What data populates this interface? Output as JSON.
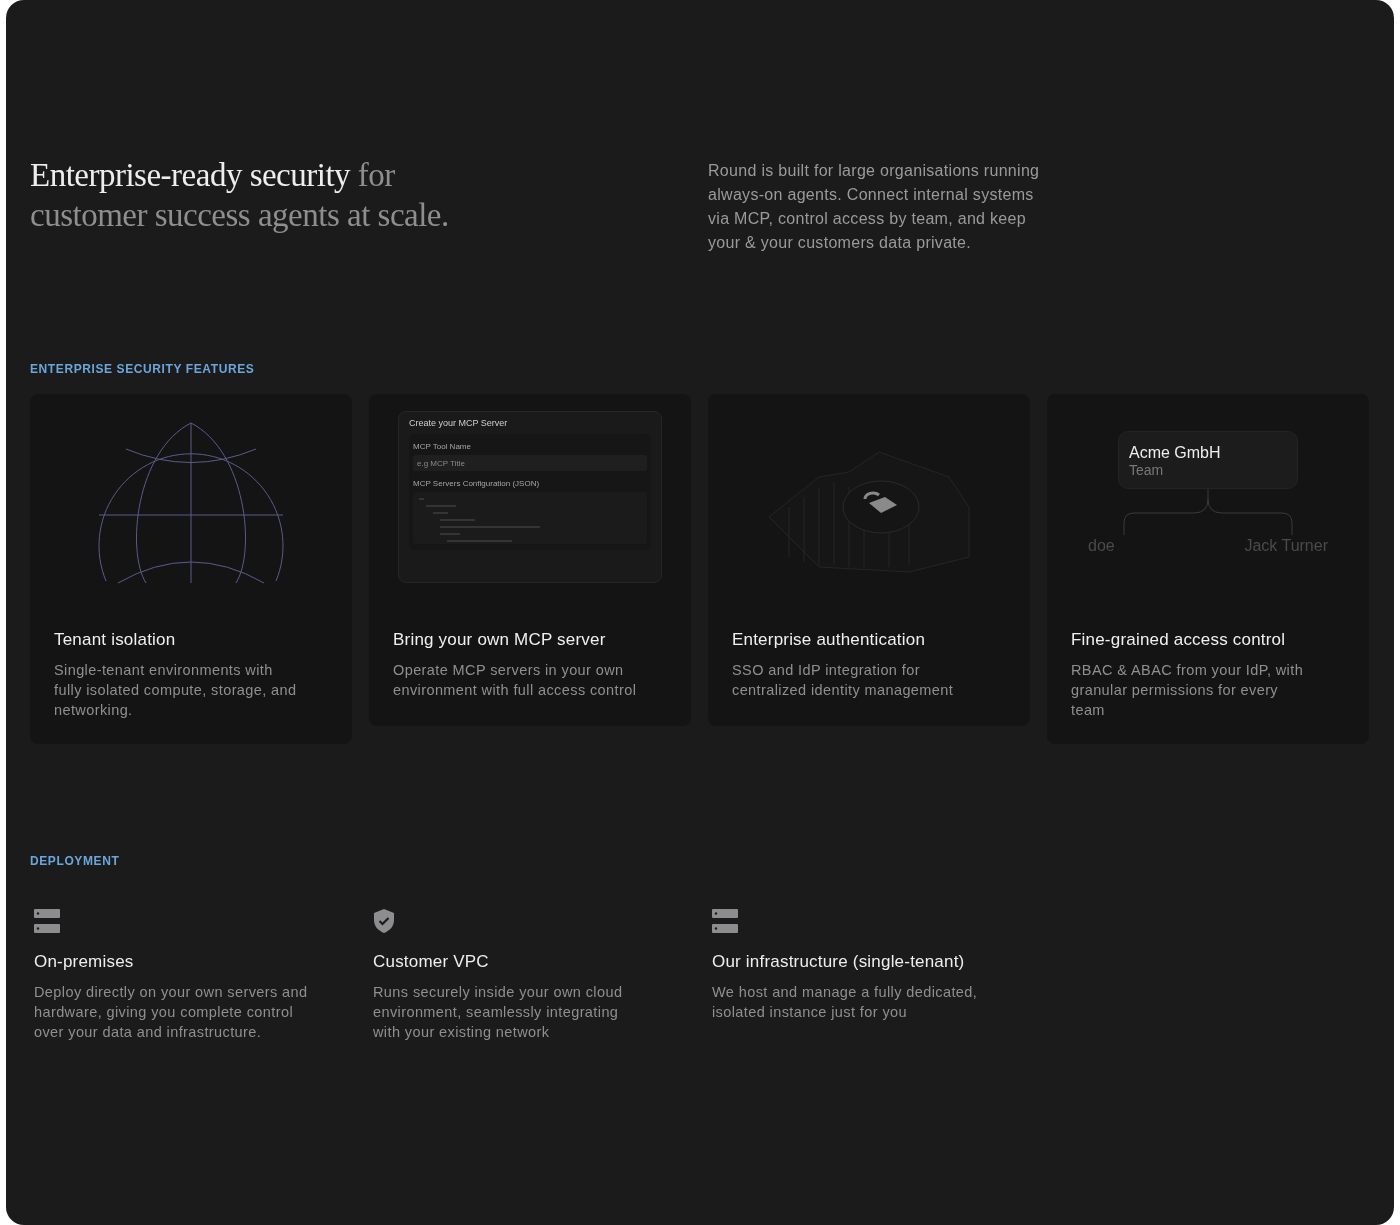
{
  "hero": {
    "title_strong": "Enterprise-ready security",
    "title_muted_1": "for",
    "title_muted_2": "customer success agents at scale.",
    "intro": "Round is built for large organisations running always-on agents. Connect internal systems via MCP, control access by team, and keep your & your customers data private."
  },
  "features": {
    "label": "ENTERPRISE SECURITY FEATURES",
    "cards": [
      {
        "kind": "globe",
        "title": "Tenant isolation",
        "description": "Single-tenant environments with fully isolated compute, storage, and networking."
      },
      {
        "kind": "mcp_form",
        "title": "Bring your own MCP server",
        "description": "Operate MCP servers in your own environment with full access control",
        "form": {
          "title": "Create your MCP Server",
          "name_label": "MCP Tool Name",
          "name_placeholder": "e.g MCP Title",
          "config_label": "MCP Servers Configuration (JSON)"
        }
      },
      {
        "kind": "lock",
        "title": "Enterprise authentication",
        "description": "SSO and IdP integration for centralized identity management"
      },
      {
        "kind": "org",
        "title": "Fine-grained access control",
        "description": "RBAC & ABAC from your IdP, with granular permissions for every team",
        "org": {
          "name": "Acme GmbH",
          "role": "Team",
          "members": [
            "doe",
            "Jack Turner"
          ]
        }
      }
    ]
  },
  "deployment": {
    "label": "DEPLOYMENT",
    "options": [
      {
        "kind": "server",
        "title": "On-premises",
        "description": "Deploy directly on your own servers and hardware, giving you complete control over your data and infrastructure."
      },
      {
        "kind": "shield",
        "title": "Customer VPC",
        "description": "Runs securely inside your own cloud environment, seamlessly integrating with your existing network"
      },
      {
        "kind": "server",
        "title": "Our infrastructure (single-tenant)",
        "description": "We host and manage a fully dedicated, isolated instance just for you"
      }
    ]
  }
}
